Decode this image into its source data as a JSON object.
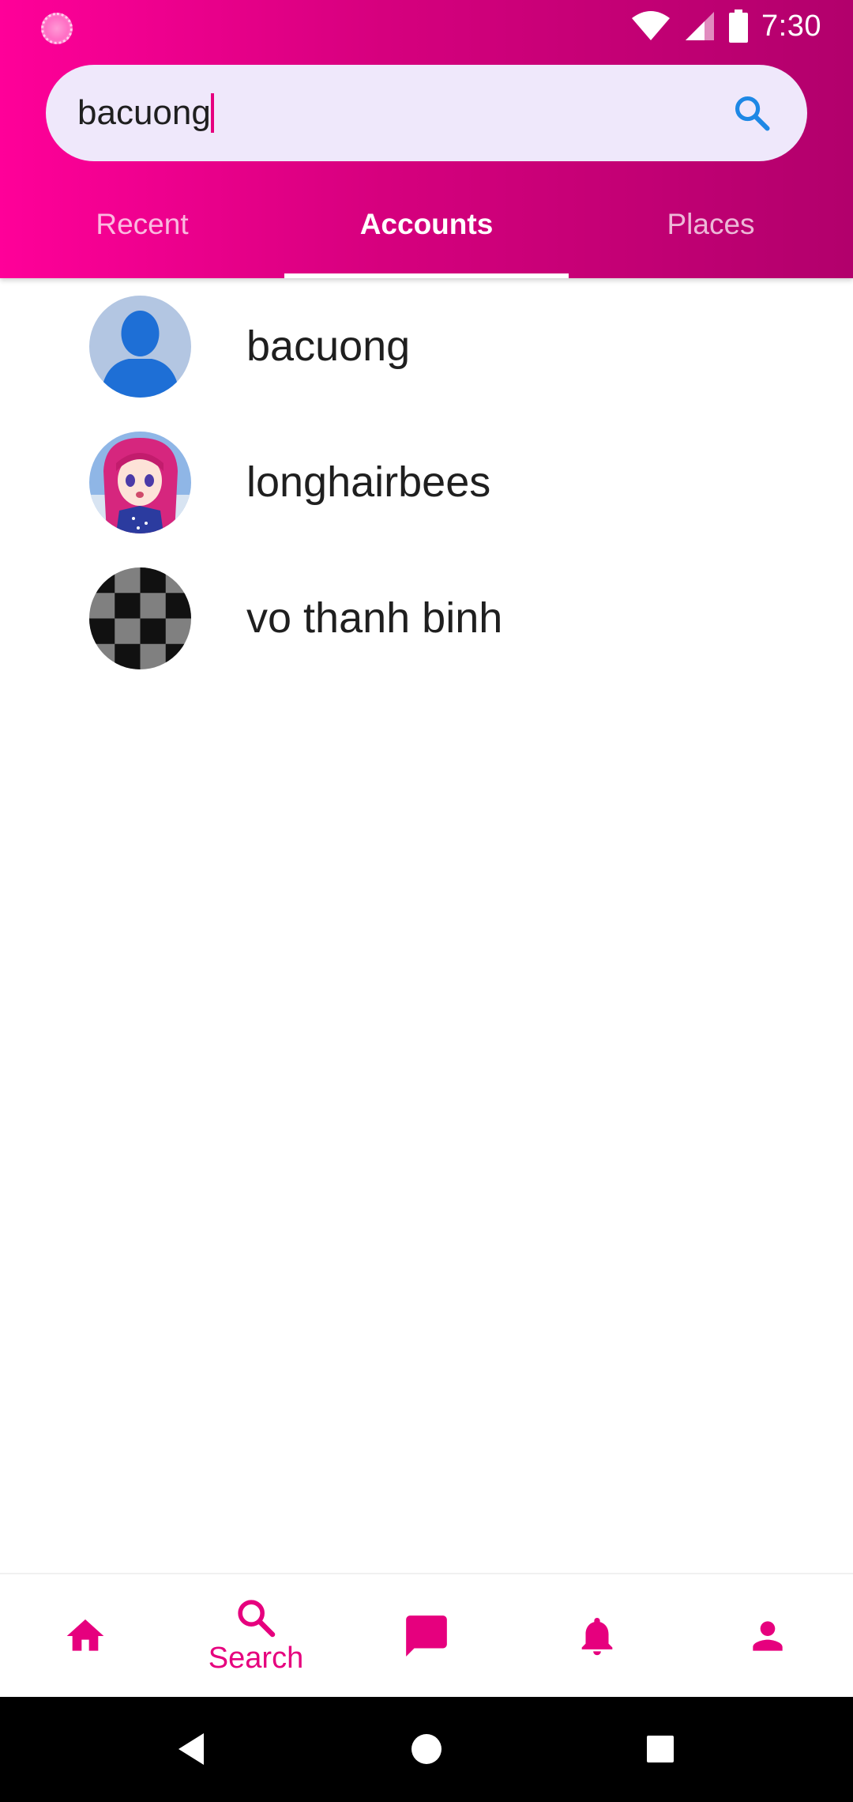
{
  "status_bar": {
    "time": "7:30",
    "icons": [
      "notification-dot-icon",
      "wifi-icon",
      "cell-signal-icon",
      "battery-icon"
    ]
  },
  "search": {
    "value": "bacuong",
    "icon": "search-icon"
  },
  "tabs": [
    {
      "label": "Recent",
      "active": false
    },
    {
      "label": "Accounts",
      "active": true
    },
    {
      "label": "Places",
      "active": false
    }
  ],
  "results": [
    {
      "name": "bacuong",
      "avatar": "default-person-avatar"
    },
    {
      "name": "longhairbees",
      "avatar": "anime-girl-avatar"
    },
    {
      "name": "vo thanh binh",
      "avatar": "checkerboard-avatar"
    }
  ],
  "bottom_nav": [
    {
      "icon": "home-icon",
      "label": ""
    },
    {
      "icon": "search-icon",
      "label": "Search",
      "active": true
    },
    {
      "icon": "chat-icon",
      "label": ""
    },
    {
      "icon": "bell-icon",
      "label": ""
    },
    {
      "icon": "person-icon",
      "label": ""
    }
  ],
  "colors": {
    "accent": "#e6007e",
    "header_start": "#ff0099",
    "header_end": "#b2006c",
    "search_bg": "#efe8fb",
    "search_icon": "#1e88e5"
  }
}
